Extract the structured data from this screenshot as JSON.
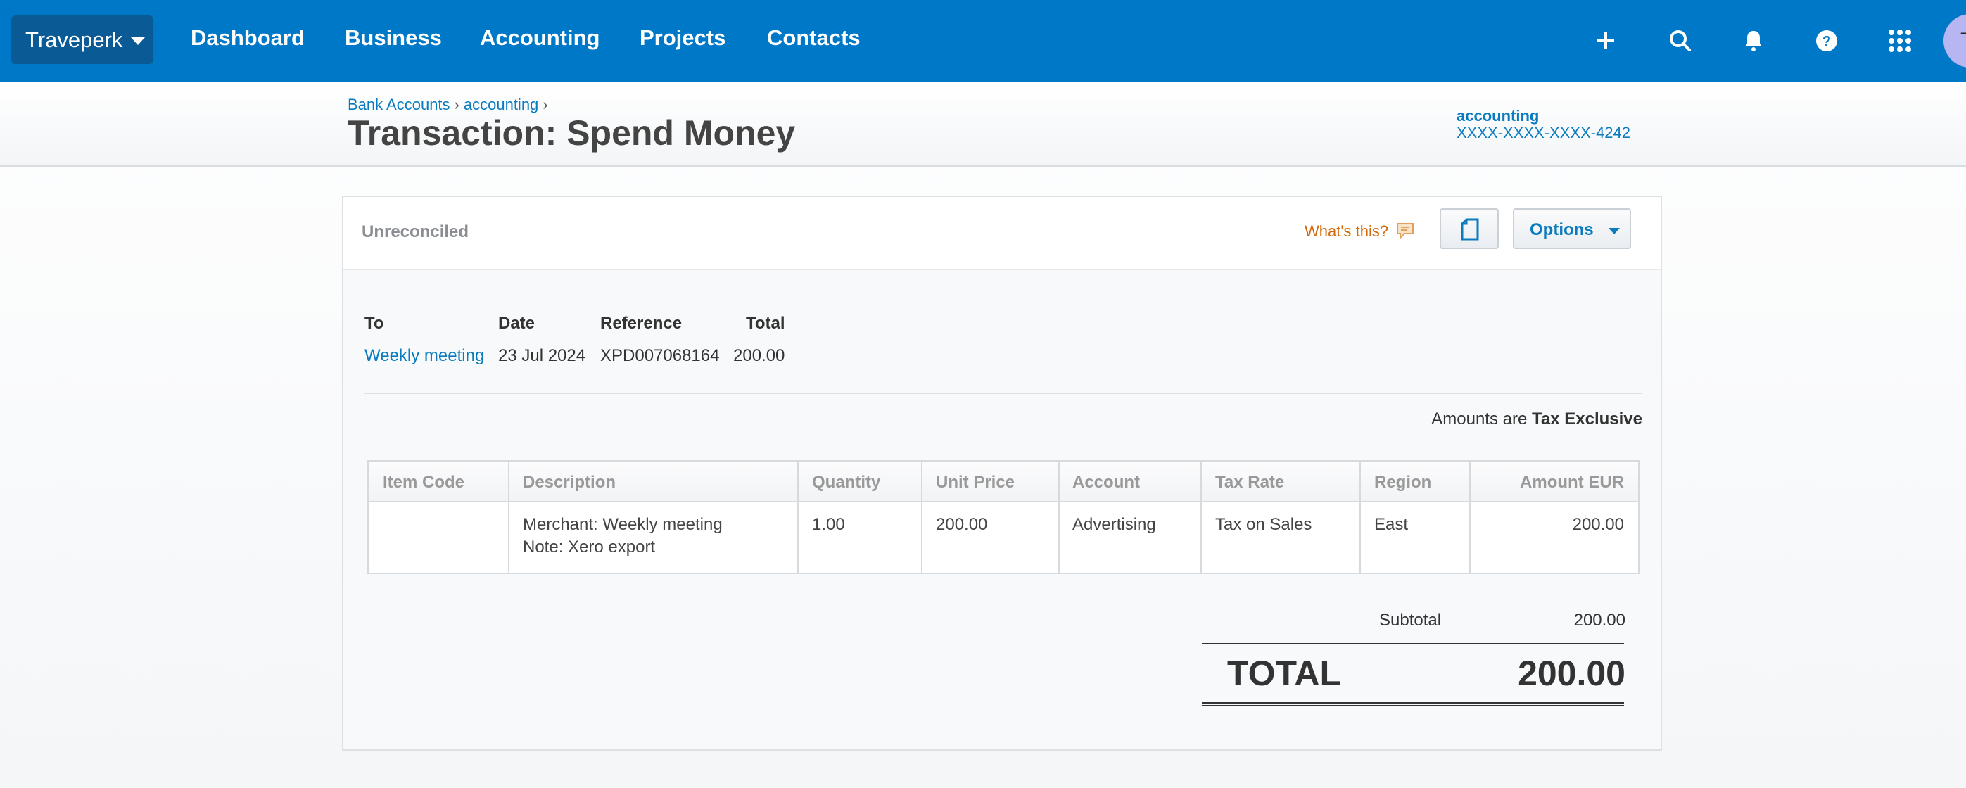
{
  "nav": {
    "org": "Traveperk",
    "items": [
      "Dashboard",
      "Business",
      "Accounting",
      "Projects",
      "Contacts"
    ],
    "avatar_initial": "T"
  },
  "header": {
    "breadcrumb": [
      "Bank Accounts",
      "accounting"
    ],
    "title": "Transaction: Spend Money",
    "account_name": "accounting",
    "account_number": "XXXX-XXXX-XXXX-4242"
  },
  "panel": {
    "status": "Unreconciled",
    "whats_this": "What's this?",
    "options_label": "Options"
  },
  "summary": {
    "headers": [
      "To",
      "Date",
      "Reference",
      "Total"
    ],
    "values": [
      "Weekly meeting",
      "23 Jul 2024",
      "XPD007068164",
      "200.00"
    ]
  },
  "tax_note": {
    "prefix": "Amounts are",
    "mode": "Tax Exclusive"
  },
  "line_items": {
    "columns": [
      "Item Code",
      "Description",
      "Quantity",
      "Unit Price",
      "Account",
      "Tax Rate",
      "Region",
      "Amount EUR"
    ],
    "rows": [
      {
        "item_code": "",
        "description_line1": "Merchant: Weekly meeting",
        "description_line2": "Note: Xero export",
        "quantity": "1.00",
        "unit_price": "200.00",
        "account": "Advertising",
        "tax_rate": "Tax on Sales",
        "region": "East",
        "amount": "200.00"
      }
    ]
  },
  "totals": {
    "subtotal_label": "Subtotal",
    "subtotal": "200.00",
    "total_label": "TOTAL",
    "total": "200.00"
  },
  "colors": {
    "nav_bg": "#0078c8",
    "link": "#0a7bbf",
    "whats_this": "#d4690b"
  }
}
